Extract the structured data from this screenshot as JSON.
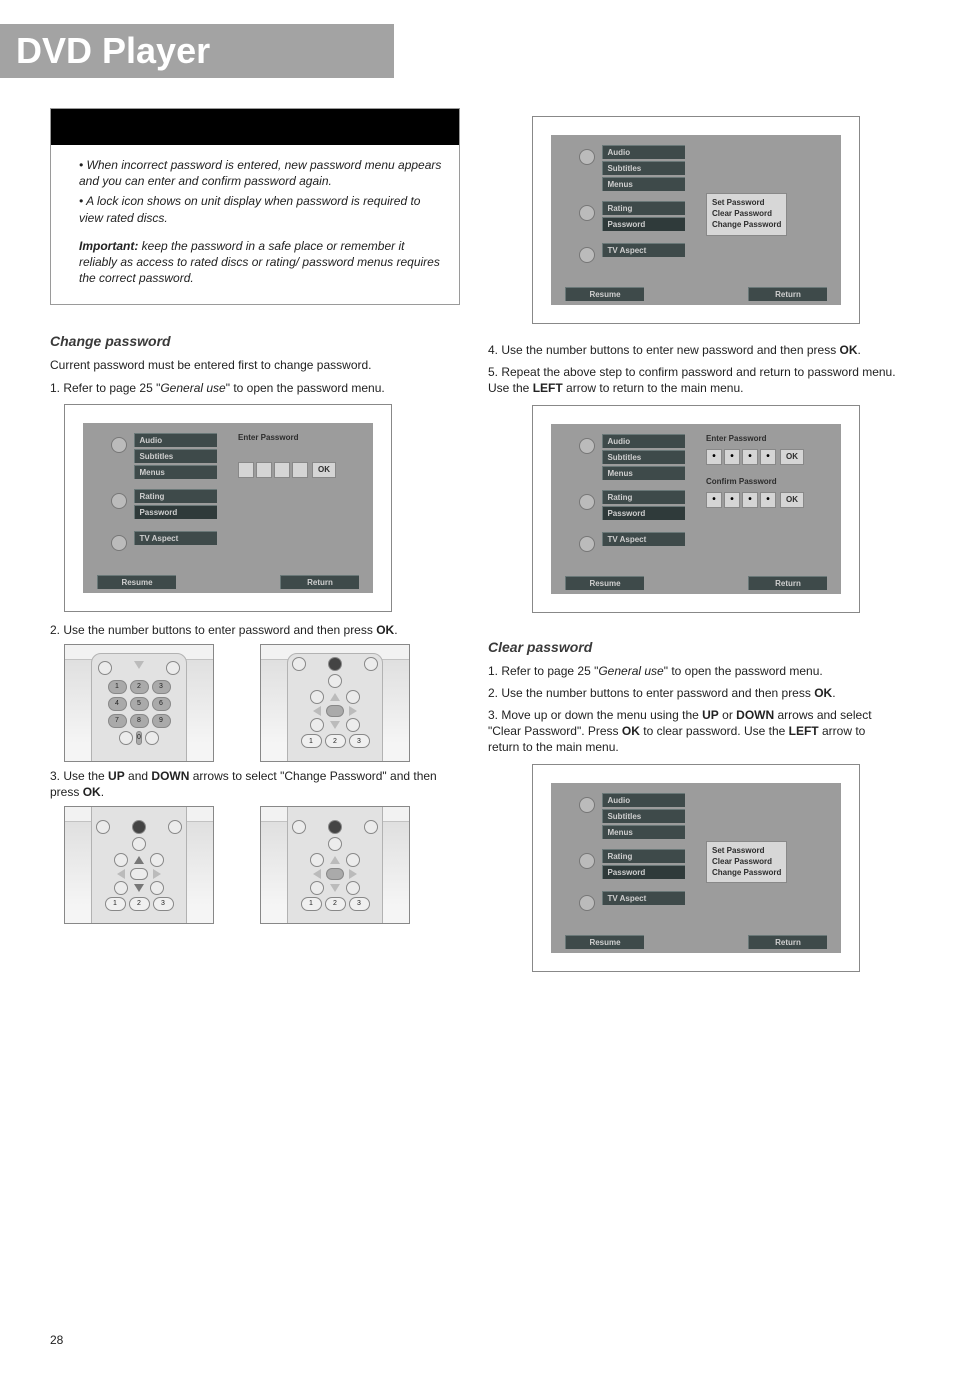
{
  "page": {
    "header_title": "DVD Player",
    "page_number": "28"
  },
  "note_box": {
    "bullet1": "• When incorrect password is entered, new password menu appears and you can enter and confirm password again.",
    "bullet2": "• A lock icon shows on unit display when password is required to view rated discs.",
    "important_label": "Important:",
    "important_text": " keep the password in a safe place or remember it reliably as access to rated discs or rating/ password menus requires the correct password."
  },
  "change_pw": {
    "heading": "Change password",
    "intro": "Current password must be entered first to change password.",
    "step1": "1. Refer to page 25 \"General use\" to open the password menu.",
    "general_use_label": "General use",
    "step2": "2. Use the number buttons to enter password and then press OK.",
    "ok_label": "OK",
    "step3": "3. Use the UP and DOWN arrows to select \"Change Password\" and then press OK.",
    "up_label": "UP",
    "down_label": "DOWN"
  },
  "change_pw_right": {
    "step4": "4. Use the number buttons to enter new password and then press OK.",
    "step5": "5. Repeat the above step to confirm password and return to password menu.  Use the LEFT arrow to return to the main menu.",
    "left_label": "LEFT",
    "ok_label": "OK"
  },
  "clear_pw": {
    "heading": "Clear password",
    "step1": "1. Refer to page 25 \"General use\" to open the password menu.",
    "general_use_label": "General use",
    "step2": "2. Use the number buttons to enter password and then press OK.",
    "step3": "3. Move up or down the menu using the UP or DOWN arrows and select \"Clear Password\".  Press OK to clear password. Use the LEFT arrow to return to the main menu.",
    "up_label": "UP",
    "down_label": "DOWN",
    "ok_label": "OK",
    "left_label": "LEFT"
  },
  "osd_labels": {
    "audio": "Audio",
    "subtitles": "Subtitles",
    "menus": "Menus",
    "rating": "Rating",
    "password": "Password",
    "tv_aspect": "TV Aspect",
    "resume": "Resume",
    "return": "Return",
    "enter_password": "Enter Password",
    "confirm_password": "Confirm Password",
    "set_password": "Set Password",
    "clear_password": "Clear Password",
    "change_password": "Change Password",
    "ok": "OK"
  },
  "remote": {
    "keys": [
      "1",
      "2",
      "3",
      "4",
      "5",
      "6",
      "7",
      "8",
      "9",
      "0"
    ]
  }
}
